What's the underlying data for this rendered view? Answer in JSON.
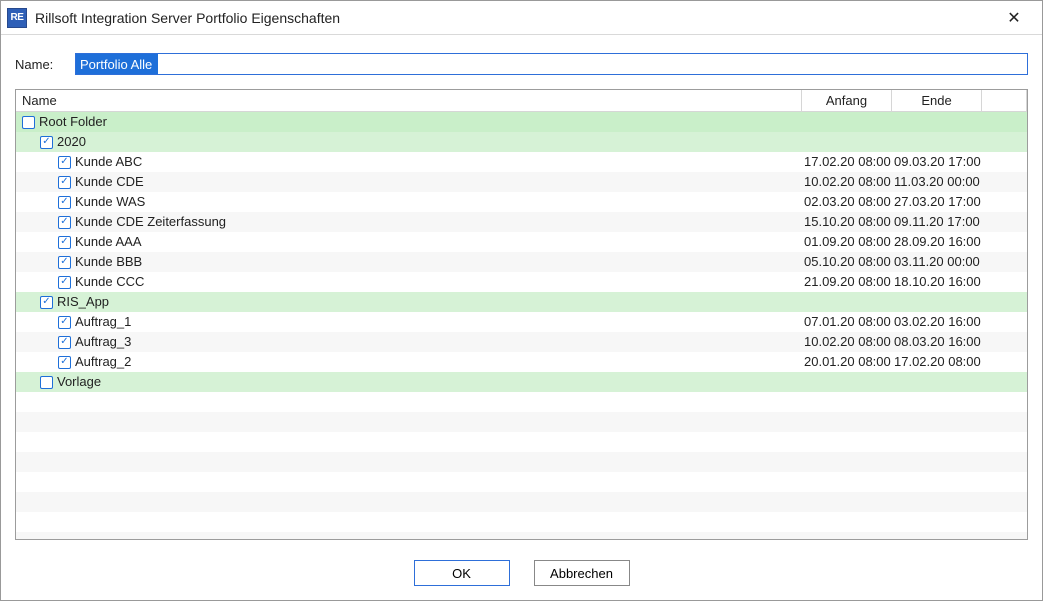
{
  "window": {
    "title": "Rillsoft Integration Server Portfolio Eigenschaften",
    "app_icon_text": "RE"
  },
  "name_field": {
    "label": "Name:",
    "value": "Portfolio Alle"
  },
  "columns": {
    "name": "Name",
    "start": "Anfang",
    "end": "Ende"
  },
  "rows": [
    {
      "indent": 0,
      "checked": false,
      "label": "Root Folder",
      "start": "",
      "end": "",
      "group": true
    },
    {
      "indent": 1,
      "checked": true,
      "label": "2020",
      "start": "",
      "end": "",
      "group": true
    },
    {
      "indent": 2,
      "checked": true,
      "label": "Kunde ABC",
      "start": "17.02.20 08:00",
      "end": "09.03.20 17:00"
    },
    {
      "indent": 2,
      "checked": true,
      "label": "Kunde CDE",
      "start": "10.02.20 08:00",
      "end": "11.03.20 00:00"
    },
    {
      "indent": 2,
      "checked": true,
      "label": "Kunde WAS",
      "start": "02.03.20 08:00",
      "end": "27.03.20 17:00"
    },
    {
      "indent": 2,
      "checked": true,
      "label": "Kunde CDE Zeiterfassung",
      "start": "15.10.20 08:00",
      "end": "09.11.20 17:00"
    },
    {
      "indent": 2,
      "checked": true,
      "label": "Kunde AAA",
      "start": "01.09.20 08:00",
      "end": "28.09.20 16:00"
    },
    {
      "indent": 2,
      "checked": true,
      "label": "Kunde BBB",
      "start": "05.10.20 08:00",
      "end": "03.11.20 00:00"
    },
    {
      "indent": 2,
      "checked": true,
      "label": "Kunde CCC",
      "start": "21.09.20 08:00",
      "end": "18.10.20 16:00"
    },
    {
      "indent": 1,
      "checked": true,
      "label": "RIS_App",
      "start": "",
      "end": "",
      "group": true
    },
    {
      "indent": 2,
      "checked": true,
      "label": "Auftrag_1",
      "start": "07.01.20 08:00",
      "end": "03.02.20 16:00"
    },
    {
      "indent": 2,
      "checked": true,
      "label": "Auftrag_3",
      "start": "10.02.20 08:00",
      "end": "08.03.20 16:00"
    },
    {
      "indent": 2,
      "checked": true,
      "label": "Auftrag_2",
      "start": "20.01.20 08:00",
      "end": "17.02.20 08:00"
    },
    {
      "indent": 1,
      "checked": false,
      "label": "Vorlage",
      "start": "",
      "end": "",
      "group": true
    }
  ],
  "empty_rows_after": 8,
  "buttons": {
    "ok": "OK",
    "cancel": "Abbrechen"
  }
}
